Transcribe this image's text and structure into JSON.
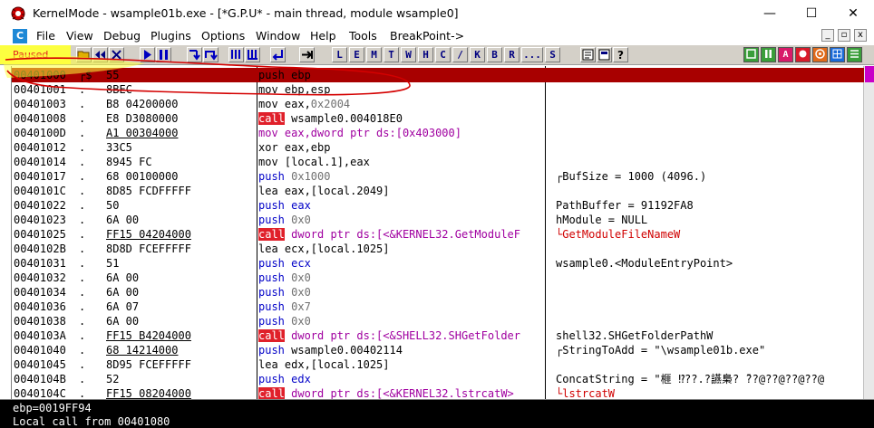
{
  "window": {
    "title": "KernelMode - wsample01b.exe - [*G.P.U* - main thread, module wsample0]",
    "minimize_glyph": "—",
    "maximize_glyph": "☐",
    "close_glyph": "✕"
  },
  "menu": {
    "items": [
      "File",
      "View",
      "Debug",
      "Plugins",
      "Options",
      "Window",
      "Help",
      "Tools",
      "BreakPoint->"
    ],
    "mdi": [
      "_",
      "▫",
      "x"
    ]
  },
  "toolbar": {
    "status": "Paused",
    "letters": [
      "L",
      "E",
      "M",
      "T",
      "W",
      "H",
      "C",
      "/",
      "K",
      "B",
      "R",
      "...",
      "S"
    ],
    "right_labels": [
      "",
      "",
      "A",
      "",
      "",
      "",
      "",
      ""
    ],
    "colors": {
      "paused_bg": "#fcff40",
      "paused_text": "#e22020",
      "call_bg": "#e0202a"
    }
  },
  "disasm": {
    "rows": [
      {
        "addr": "00401000",
        "mark": "┌$",
        "hex": "55",
        "asm": [
          {
            "t": "push",
            "c": "blue"
          },
          {
            "t": " ebp",
            "c": "dark"
          }
        ],
        "cmt": "",
        "sel": true
      },
      {
        "addr": "00401001",
        "mark": ".",
        "hex": "8BEC",
        "asm": [
          {
            "t": "mov ebp,esp",
            "c": "dark"
          }
        ],
        "cmt": ""
      },
      {
        "addr": "00401003",
        "mark": ".",
        "hex": "B8 04200000",
        "asm": [
          {
            "t": "mov eax,",
            "c": "dark"
          },
          {
            "t": "0x2004",
            "c": "gray"
          }
        ],
        "cmt": ""
      },
      {
        "addr": "00401008",
        "mark": ".",
        "hex": "E8 D3080000",
        "asm": [
          {
            "t": "call",
            "c": "call"
          },
          {
            "t": " wsample0.004018E0",
            "c": "dark"
          }
        ],
        "cmt": ""
      },
      {
        "addr": "0040100D",
        "mark": ".",
        "hex": "A1 00304000",
        "hexUnder": true,
        "asm": [
          {
            "t": "mov eax,dword ptr ds:[0x403000]",
            "c": "mag"
          }
        ],
        "cmt": ""
      },
      {
        "addr": "00401012",
        "mark": ".",
        "hex": "33C5",
        "asm": [
          {
            "t": "xor eax,ebp",
            "c": "dark"
          }
        ],
        "cmt": ""
      },
      {
        "addr": "00401014",
        "mark": ".",
        "hex": "8945 FC",
        "asm": [
          {
            "t": "mov [local.1],eax",
            "c": "dark"
          }
        ],
        "cmt": ""
      },
      {
        "addr": "00401017",
        "mark": ".",
        "hex": "68 00100000",
        "asm": [
          {
            "t": "push",
            "c": "blue"
          },
          {
            "t": " 0x1000",
            "c": "gray"
          }
        ],
        "cmt": "┌BufSize = 1000 (4096.)"
      },
      {
        "addr": "0040101C",
        "mark": ".",
        "hex": "8D85 FCDFFFFF",
        "asm": [
          {
            "t": "lea eax,[local.2049]",
            "c": "dark"
          }
        ],
        "cmt": ""
      },
      {
        "addr": "00401022",
        "mark": ".",
        "hex": "50",
        "asm": [
          {
            "t": "push",
            "c": "blue"
          },
          {
            "t": " eax",
            "c": "blue"
          }
        ],
        "cmt": " PathBuffer = 91192FA8"
      },
      {
        "addr": "00401023",
        "mark": ".",
        "hex": "6A 00",
        "asm": [
          {
            "t": "push",
            "c": "blue"
          },
          {
            "t": " 0x0",
            "c": "gray"
          }
        ],
        "cmt": " hModule = NULL"
      },
      {
        "addr": "00401025",
        "mark": ".",
        "hex": "FF15 04204000",
        "hexUnder": true,
        "asm": [
          {
            "t": "call",
            "c": "call"
          },
          {
            "t": " dword ptr ds:[<&KERNEL32.GetModuleF",
            "c": "mag"
          }
        ],
        "cmt": "└GetModuleFileNameW",
        "cmtRed": true
      },
      {
        "addr": "0040102B",
        "mark": ".",
        "hex": "8D8D FCEFFFFF",
        "asm": [
          {
            "t": "lea ecx,[local.1025]",
            "c": "dark"
          }
        ],
        "cmt": ""
      },
      {
        "addr": "00401031",
        "mark": ".",
        "hex": "51",
        "asm": [
          {
            "t": "push",
            "c": "blue"
          },
          {
            "t": " ecx",
            "c": "blue"
          }
        ],
        "cmt": " wsample0.<ModuleEntryPoint>"
      },
      {
        "addr": "00401032",
        "mark": ".",
        "hex": "6A 00",
        "asm": [
          {
            "t": "push",
            "c": "blue"
          },
          {
            "t": " 0x0",
            "c": "gray"
          }
        ],
        "cmt": ""
      },
      {
        "addr": "00401034",
        "mark": ".",
        "hex": "6A 00",
        "asm": [
          {
            "t": "push",
            "c": "blue"
          },
          {
            "t": " 0x0",
            "c": "gray"
          }
        ],
        "cmt": ""
      },
      {
        "addr": "00401036",
        "mark": ".",
        "hex": "6A 07",
        "asm": [
          {
            "t": "push",
            "c": "blue"
          },
          {
            "t": " 0x7",
            "c": "gray"
          }
        ],
        "cmt": ""
      },
      {
        "addr": "00401038",
        "mark": ".",
        "hex": "6A 00",
        "asm": [
          {
            "t": "push",
            "c": "blue"
          },
          {
            "t": " 0x0",
            "c": "gray"
          }
        ],
        "cmt": ""
      },
      {
        "addr": "0040103A",
        "mark": ".",
        "hex": "FF15 B4204000",
        "hexUnder": true,
        "asm": [
          {
            "t": "call",
            "c": "call"
          },
          {
            "t": " dword ptr ds:[<&SHELL32.SHGetFolder",
            "c": "mag"
          }
        ],
        "cmt": " shell32.SHGetFolderPathW"
      },
      {
        "addr": "00401040",
        "mark": ".",
        "hex": "68 14214000",
        "hexUnder": true,
        "asm": [
          {
            "t": "push",
            "c": "blue"
          },
          {
            "t": " wsample0.00402114",
            "c": "dark"
          }
        ],
        "cmt": "┌StringToAdd = \"\\wsample01b.exe\""
      },
      {
        "addr": "00401045",
        "mark": ".",
        "hex": "8D95 FCEFFFFF",
        "asm": [
          {
            "t": "lea edx,[local.1025]",
            "c": "dark"
          }
        ],
        "cmt": ""
      },
      {
        "addr": "0040104B",
        "mark": ".",
        "hex": "52",
        "asm": [
          {
            "t": "push",
            "c": "blue"
          },
          {
            "t": " edx",
            "c": "blue"
          }
        ],
        "cmt": " ConcatString = \"榧 ⁉??.?讌梟? ̄??@??@??@??@"
      },
      {
        "addr": "0040104C",
        "mark": ".",
        "hex": "FF15 08204000",
        "hexUnder": true,
        "asm": [
          {
            "t": "call",
            "c": "call"
          },
          {
            "t": " dword ptr ds:[<&KERNEL32.lstrcatW>",
            "c": "mag"
          }
        ],
        "cmt": "└lstrcatW",
        "cmtRed": true
      }
    ],
    "asm_colors": {
      "dark": "#000000",
      "blue": "#0000c8",
      "mag": "#a000a0",
      "gray": "#707070",
      "red": "#d00000"
    }
  },
  "info": {
    "line1": "ebp=0019FF94",
    "line2": "Local call from 00401080"
  }
}
